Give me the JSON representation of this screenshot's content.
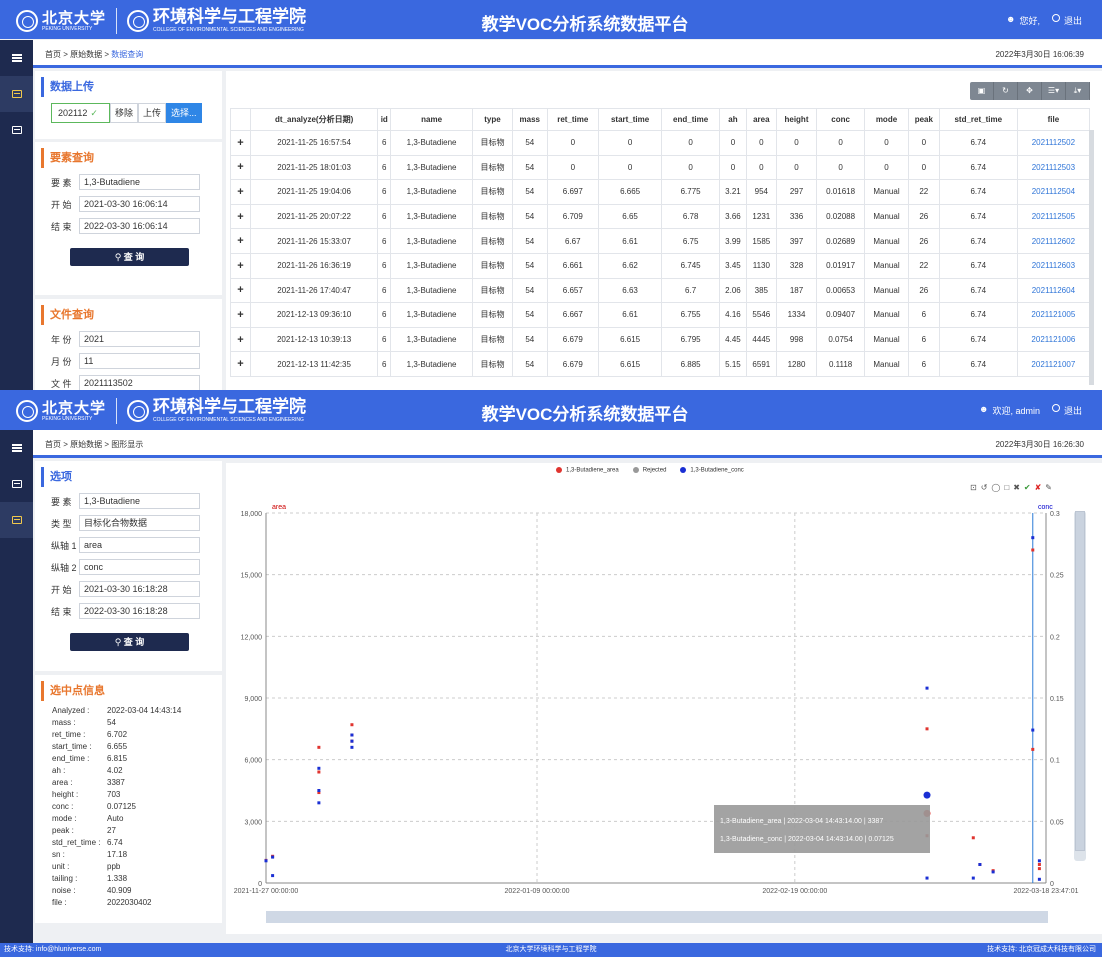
{
  "header": {
    "univ_cn": "北京大学",
    "univ_en": "PEKING UNIVERSITY",
    "college_cn": "环境科学与工程学院",
    "college_en": "COLLEGE OF ENVIRONMENTAL SCIENCES AND ENGINEERING",
    "title": "教学VOC分析系统数据平台",
    "user1": "您好,",
    "user2": "欢迎, admin",
    "logout": "退出"
  },
  "s1": {
    "breadcrumb": {
      "home": "首页 >",
      "raw": "原始数据 >",
      "current": "数据查询"
    },
    "datetime": "2022年3月30日 16:06:39",
    "upload": {
      "title": "数据上传",
      "file": "202112",
      "remove": "移除",
      "upload": "上传",
      "choose": "选择..."
    },
    "element_query": {
      "title": "要素查询",
      "element_label": "要 素",
      "element_value": "1,3-Butadiene",
      "start_label": "开 始",
      "start_value": "2021-03-30 16:06:14",
      "end_label": "结 束",
      "end_value": "2022-03-30 16:06:14",
      "query_button": "查 询"
    },
    "file_query": {
      "title": "文件查询",
      "year_label": "年 份",
      "year_value": "2021",
      "month_label": "月 份",
      "month_value": "11",
      "file_label": "文 件",
      "file_value": "2021113502"
    },
    "table": {
      "columns": [
        "dt_analyze(分析日期)",
        "id",
        "name",
        "type",
        "mass",
        "ret_time",
        "start_time",
        "end_time",
        "ah",
        "area",
        "height",
        "conc",
        "mode",
        "peak",
        "std_ret_time",
        "file"
      ],
      "rows": [
        [
          "2021-11-25 16:57:54",
          "6",
          "1,3-Butadiene",
          "目标物",
          "54",
          "0",
          "0",
          "0",
          "0",
          "0",
          "0",
          "0",
          "0",
          "0",
          "6.74",
          "2021112502"
        ],
        [
          "2021-11-25 18:01:03",
          "6",
          "1,3-Butadiene",
          "目标物",
          "54",
          "0",
          "0",
          "0",
          "0",
          "0",
          "0",
          "0",
          "0",
          "0",
          "6.74",
          "2021112503"
        ],
        [
          "2021-11-25 19:04:06",
          "6",
          "1,3-Butadiene",
          "目标物",
          "54",
          "6.697",
          "6.665",
          "6.775",
          "3.21",
          "954",
          "297",
          "0.01618",
          "Manual",
          "22",
          "6.74",
          "2021112504"
        ],
        [
          "2021-11-25 20:07:22",
          "6",
          "1,3-Butadiene",
          "目标物",
          "54",
          "6.709",
          "6.65",
          "6.78",
          "3.66",
          "1231",
          "336",
          "0.02088",
          "Manual",
          "26",
          "6.74",
          "2021112505"
        ],
        [
          "2021-11-26 15:33:07",
          "6",
          "1,3-Butadiene",
          "目标物",
          "54",
          "6.67",
          "6.61",
          "6.75",
          "3.99",
          "1585",
          "397",
          "0.02689",
          "Manual",
          "26",
          "6.74",
          "2021112602"
        ],
        [
          "2021-11-26 16:36:19",
          "6",
          "1,3-Butadiene",
          "目标物",
          "54",
          "6.661",
          "6.62",
          "6.745",
          "3.45",
          "1130",
          "328",
          "0.01917",
          "Manual",
          "22",
          "6.74",
          "2021112603"
        ],
        [
          "2021-11-26 17:40:47",
          "6",
          "1,3-Butadiene",
          "目标物",
          "54",
          "6.657",
          "6.63",
          "6.7",
          "2.06",
          "385",
          "187",
          "0.00653",
          "Manual",
          "26",
          "6.74",
          "2021112604"
        ],
        [
          "2021-12-13 09:36:10",
          "6",
          "1,3-Butadiene",
          "目标物",
          "54",
          "6.667",
          "6.61",
          "6.755",
          "4.16",
          "5546",
          "1334",
          "0.09407",
          "Manual",
          "6",
          "6.74",
          "2021121005"
        ],
        [
          "2021-12-13 10:39:13",
          "6",
          "1,3-Butadiene",
          "目标物",
          "54",
          "6.679",
          "6.615",
          "6.795",
          "4.45",
          "4445",
          "998",
          "0.0754",
          "Manual",
          "6",
          "6.74",
          "2021121006"
        ],
        [
          "2021-12-13 11:42:35",
          "6",
          "1,3-Butadiene",
          "目标物",
          "54",
          "6.679",
          "6.615",
          "6.885",
          "5.15",
          "6591",
          "1280",
          "0.1118",
          "Manual",
          "6",
          "6.74",
          "2021121007"
        ]
      ]
    }
  },
  "s2": {
    "breadcrumb": {
      "home": "首页 >",
      "raw": "原始数据 >",
      "current": "图形显示"
    },
    "datetime": "2022年3月30日 16:26:30",
    "options": {
      "title": "选项",
      "element_label": "要 素",
      "element_value": "1,3-Butadiene",
      "type_label": "类 型",
      "type_value": "目标化合物数据",
      "y1_label": "纵轴 1",
      "y1_value": "area",
      "y2_label": "纵轴 2",
      "y2_value": "conc",
      "start_label": "开 始",
      "start_value": "2021-03-30 16:18:28",
      "end_label": "结 束",
      "end_value": "2022-03-30 16:18:28",
      "query_button": "查 询"
    },
    "selected": {
      "title": "选中点信息",
      "items": [
        [
          "Analyzed :",
          "2022-03-04 14:43:14"
        ],
        [
          "mass :",
          "54"
        ],
        [
          "ret_time :",
          "6.702"
        ],
        [
          "start_time :",
          "6.655"
        ],
        [
          "end_time :",
          "6.815"
        ],
        [
          "ah :",
          "4.02"
        ],
        [
          "area :",
          "3387"
        ],
        [
          "height :",
          "703"
        ],
        [
          "conc :",
          "0.07125"
        ],
        [
          "mode :",
          "Auto"
        ],
        [
          "peak :",
          "27"
        ],
        [
          "std_ret_time :",
          "6.74"
        ],
        [
          "sn :",
          "17.18"
        ],
        [
          "unit :",
          "ppb"
        ],
        [
          "tailing :",
          "1.338"
        ],
        [
          "noise :",
          "40.909"
        ],
        [
          "file :",
          "2022030402"
        ]
      ]
    },
    "chart_legend": [
      "1,3-Butadiene_area",
      "Rejected",
      "1,3-Butadiene_conc"
    ],
    "tooltip": [
      "1,3-Butadiene_area | 2022-03-04 14:43:14.00 | 3387",
      "1,3-Butadiene_conc | 2022-03-04 14:43:14.00 | 0.07125"
    ]
  },
  "chart_data": {
    "type": "scatter",
    "title": "",
    "y1_label": "area",
    "y2_label": "conc",
    "y1_ticks": [
      "0",
      "3,000",
      "6,000",
      "9,000",
      "12,000",
      "15,000",
      "18,000"
    ],
    "y2_ticks": [
      "0",
      "0.05",
      "0.1",
      "0.15",
      "0.2",
      "0.25",
      "0.3"
    ],
    "x_ticks": [
      "2021-11-27 00:00:00",
      "2022-01-09 00:00:00",
      "2022-02-19 00:00:00",
      "2022-03-18 23:47:01"
    ],
    "ylim_area": [
      0,
      18000
    ],
    "ylim_conc": [
      0,
      0.3
    ],
    "series": [
      {
        "name": "1,3-Butadiene_area",
        "color": "#e0342f",
        "points": [
          [
            0,
            1100
          ],
          [
            1,
            1300
          ],
          [
            8,
            4400
          ],
          [
            8,
            5400
          ],
          [
            8,
            6600
          ],
          [
            13,
            7200
          ],
          [
            13,
            7700
          ],
          [
            13,
            6900
          ],
          [
            100,
            2300
          ],
          [
            100,
            7500
          ],
          [
            100,
            3300
          ],
          [
            107,
            2200
          ],
          [
            108,
            900
          ],
          [
            110,
            600
          ],
          [
            116,
            16200
          ],
          [
            116,
            6500
          ],
          [
            117,
            900
          ],
          [
            117,
            700
          ]
        ]
      },
      {
        "name": "1,3-Butadiene_conc",
        "color": "#1a2fd4",
        "points": [
          [
            0,
            0.018
          ],
          [
            1,
            0.021
          ],
          [
            1,
            0.006
          ],
          [
            8,
            0.075
          ],
          [
            8,
            0.065
          ],
          [
            8,
            0.093
          ],
          [
            13,
            0.11
          ],
          [
            13,
            0.12
          ],
          [
            13,
            0.115
          ],
          [
            100,
            0.158
          ],
          [
            100,
            0.071
          ],
          [
            100,
            0.004
          ],
          [
            107,
            0.004
          ],
          [
            108,
            0.015
          ],
          [
            110,
            0.009
          ],
          [
            116,
            0.28
          ],
          [
            116,
            0.124
          ],
          [
            117,
            0.018
          ],
          [
            117,
            0.003
          ]
        ]
      },
      {
        "name": "Rejected",
        "color": "#999999",
        "points": []
      }
    ]
  },
  "footer": {
    "left": "技术支持: info@hluniverse.com",
    "center": "北京大学环境科学与工程学院",
    "right": "技术支持: 北京冠成大科技有限公司"
  }
}
